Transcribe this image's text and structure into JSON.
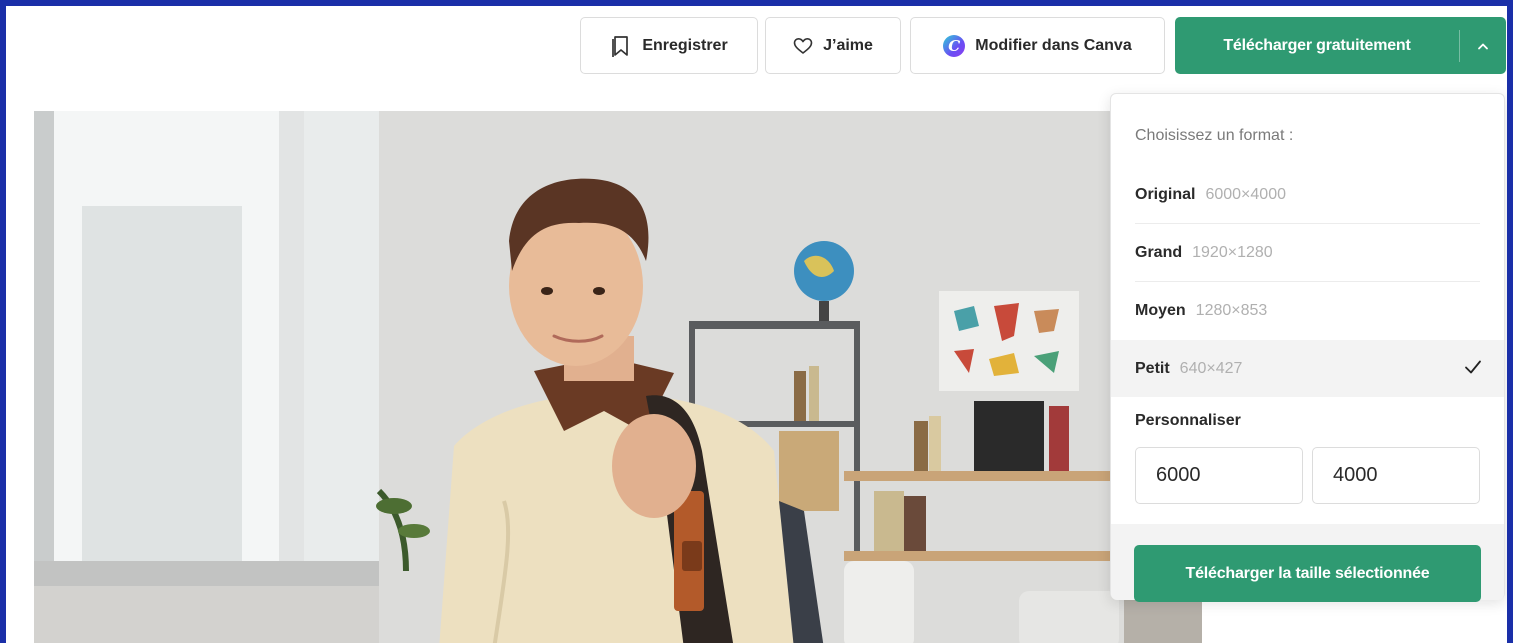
{
  "toolbar": {
    "save_label": "Enregistrer",
    "like_label": "J’aime",
    "canva_label": "Modifier dans Canva",
    "download_label": "Télécharger gratuitement"
  },
  "dropdown": {
    "title": "Choisissez un format :",
    "formats": [
      {
        "name": "Original",
        "size": "6000×4000",
        "selected": false
      },
      {
        "name": "Grand",
        "size": "1920×1280",
        "selected": false
      },
      {
        "name": "Moyen",
        "size": "1280×853",
        "selected": false
      },
      {
        "name": "Petit",
        "size": "640×427",
        "selected": true
      }
    ],
    "custom_label": "Personnaliser",
    "custom_width": "6000",
    "custom_height": "4000",
    "download_selected_label": "Télécharger la taille sélectionnée"
  },
  "colors": {
    "accent_green": "#2f9a72",
    "border_blue": "#1a2fa8"
  }
}
